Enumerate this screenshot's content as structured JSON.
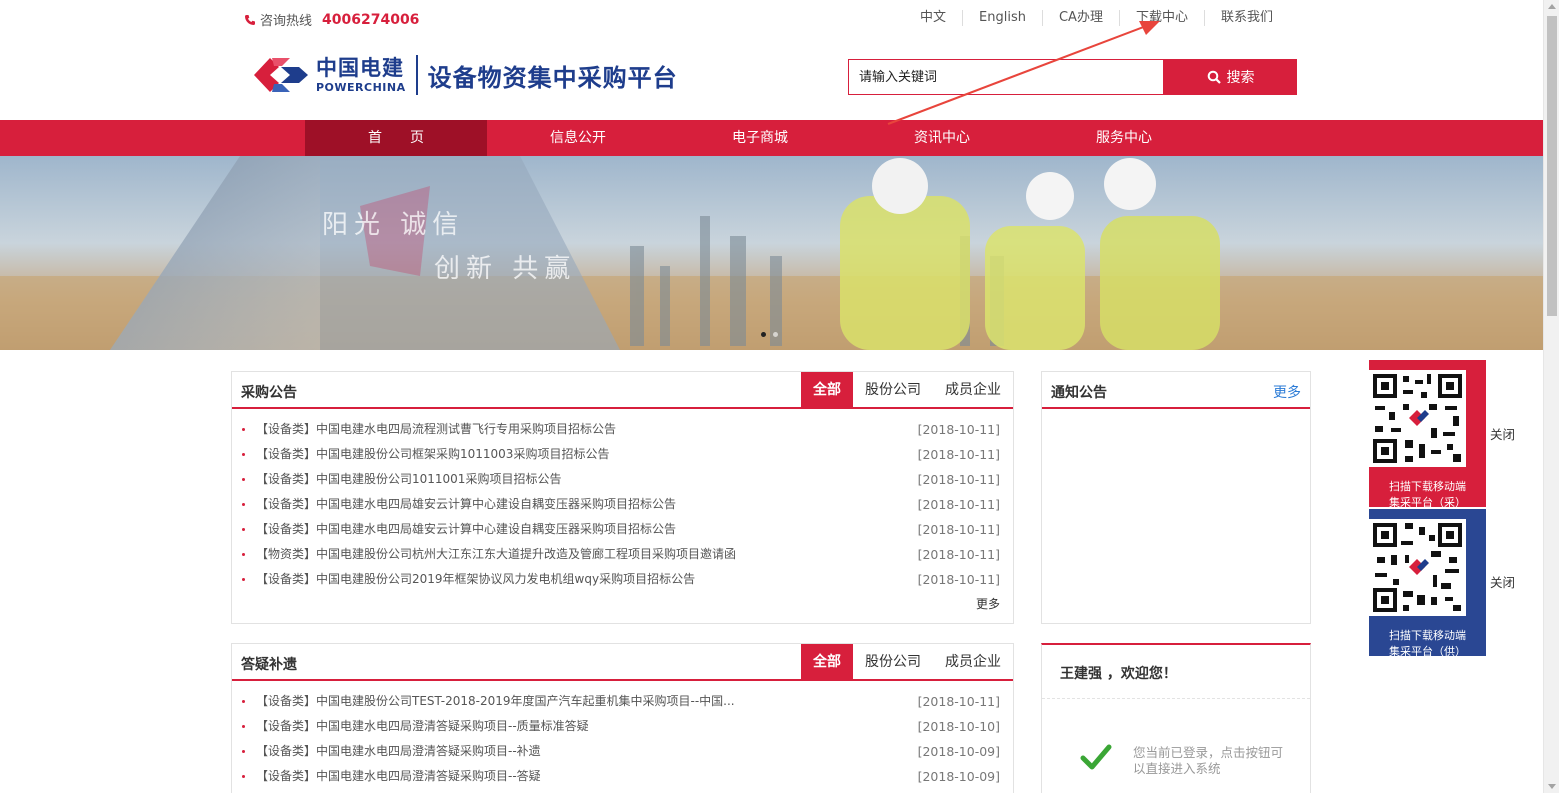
{
  "topbar": {
    "hotline_label": "咨询热线",
    "hotline_number": "4006274006",
    "links": [
      "中文",
      "English",
      "CA办理",
      "下载中心",
      "联系我们"
    ]
  },
  "logo": {
    "cn_name": "中国电建",
    "en_name": "POWERCHINA",
    "platform_title": "设备物资集中采购平台"
  },
  "search": {
    "placeholder": "请输入关键词",
    "button_label": "搜索"
  },
  "nav": {
    "items": [
      "首　　页",
      "信息公开",
      "电子商城",
      "资讯中心",
      "服务中心"
    ],
    "active": 0
  },
  "banner": {
    "slogan1": "阳光 诚信",
    "slogan2": "创新 共赢"
  },
  "procurement": {
    "title": "采购公告",
    "tabs": [
      "全部",
      "股份公司",
      "成员企业"
    ],
    "items": [
      {
        "text": "【设备类】中国电建水电四局流程测试曹飞行专用采购项目招标公告",
        "date": "[2018-10-11]"
      },
      {
        "text": "【设备类】中国电建股份公司框架采购1011003采购项目招标公告",
        "date": "[2018-10-11]"
      },
      {
        "text": "【设备类】中国电建股份公司1011001采购项目招标公告",
        "date": "[2018-10-11]"
      },
      {
        "text": "【设备类】中国电建水电四局雄安云计算中心建设自耦变压器采购项目招标公告",
        "date": "[2018-10-11]"
      },
      {
        "text": "【设备类】中国电建水电四局雄安云计算中心建设自耦变压器采购项目招标公告",
        "date": "[2018-10-11]"
      },
      {
        "text": "【物资类】中国电建股份公司杭州大江东江东大道提升改造及管廊工程项目采购项目邀请函",
        "date": "[2018-10-11]"
      },
      {
        "text": "【设备类】中国电建股份公司2019年框架协议风力发电机组wqy采购项目招标公告",
        "date": "[2018-10-11]"
      }
    ],
    "more": "更多"
  },
  "qa": {
    "title": "答疑补遗",
    "tabs": [
      "全部",
      "股份公司",
      "成员企业"
    ],
    "items": [
      {
        "text": "【设备类】中国电建股份公司TEST-2018-2019年度国产汽车起重机集中采购项目--中国...",
        "date": "[2018-10-11]"
      },
      {
        "text": "【设备类】中国电建水电四局澄清答疑采购项目--质量标准答疑",
        "date": "[2018-10-10]"
      },
      {
        "text": "【设备类】中国电建水电四局澄清答疑采购项目--补遗",
        "date": "[2018-10-09]"
      },
      {
        "text": "【设备类】中国电建水电四局澄清答疑采购项目--答疑",
        "date": "[2018-10-09]"
      }
    ]
  },
  "notice": {
    "title": "通知公告",
    "more": "更多"
  },
  "user": {
    "welcome": "王建强 ，欢迎您！",
    "message": "您当前已登录，点击按钮可以直接进入系统"
  },
  "qr": [
    {
      "caption_line1": "扫描下载移动端",
      "caption_line2": "集采平台（采）",
      "close": "关闭"
    },
    {
      "caption_line1": "扫描下载移动端",
      "caption_line2": "集采平台（供）",
      "close": "关闭"
    }
  ],
  "colors": {
    "brand_red": "#d71f3c",
    "brand_red_dark": "#9e1027",
    "brand_blue": "#1e3d8c",
    "qr_blue": "#2a4793",
    "link_blue": "#2b7bd6",
    "annotation_arrow": "#e8453c"
  }
}
